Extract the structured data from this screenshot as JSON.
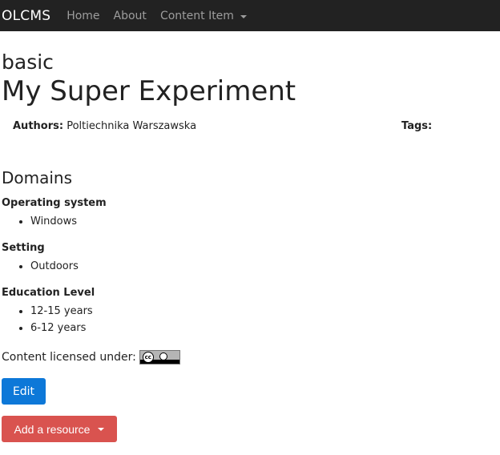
{
  "navbar": {
    "brand": "OLCMS",
    "links": [
      {
        "label": "Home"
      },
      {
        "label": "About"
      },
      {
        "label": "Content Item"
      }
    ]
  },
  "page": {
    "subtitle": "basic",
    "title": "My Super Experiment",
    "authors_label": "Authors:",
    "authors_value": "Poltiechnika Warszawska",
    "tags_label": "Tags:"
  },
  "domains": {
    "heading": "Domains",
    "groups": [
      {
        "label": "Operating system",
        "items": [
          "Windows"
        ]
      },
      {
        "label": "Setting",
        "items": [
          "Outdoors"
        ]
      },
      {
        "label": "Education Level",
        "items": [
          "12-15 years",
          "6-12 years"
        ]
      }
    ]
  },
  "license": {
    "text": "Content licensed under:",
    "badge_text": "cc"
  },
  "actions": {
    "edit_label": "Edit",
    "add_resource_label": "Add a resource"
  }
}
